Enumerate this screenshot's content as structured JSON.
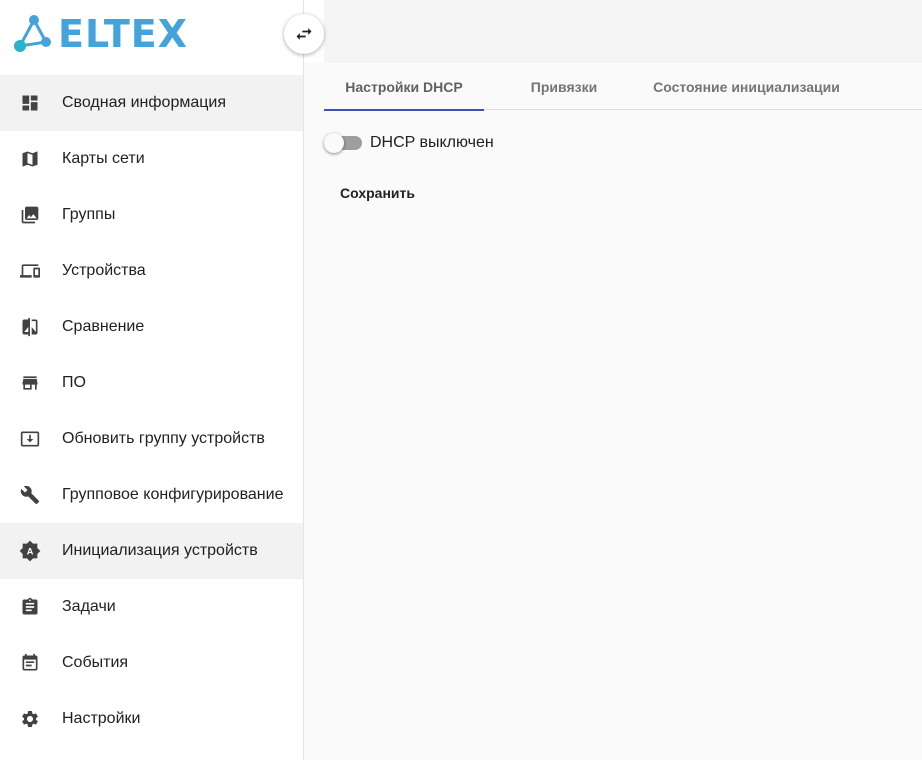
{
  "logo": {
    "text": "ELTEX",
    "mark_colors": [
      "#45a3dc",
      "#2bb1c9"
    ]
  },
  "toggle": {
    "icon": "swap-horiz-icon"
  },
  "sidebar": {
    "items": [
      {
        "label": "Сводная информация",
        "icon": "dashboard-icon",
        "active": true
      },
      {
        "label": "Карты сети",
        "icon": "map-icon",
        "active": false
      },
      {
        "label": "Группы",
        "icon": "photo-library-icon",
        "active": false
      },
      {
        "label": "Устройства",
        "icon": "devices-icon",
        "active": false
      },
      {
        "label": "Сравнение",
        "icon": "compare-icon",
        "active": false
      },
      {
        "label": "ПО",
        "icon": "store-icon",
        "active": false
      },
      {
        "label": "Обновить группу устройств",
        "icon": "system-update-icon",
        "active": false
      },
      {
        "label": "Групповое конфигурирование",
        "icon": "wrench-icon",
        "active": false
      },
      {
        "label": "Инициализация устройств",
        "icon": "brightness-auto-icon",
        "active": true
      },
      {
        "label": "Задачи",
        "icon": "assignment-icon",
        "active": false
      },
      {
        "label": "События",
        "icon": "event-note-icon",
        "active": false
      },
      {
        "label": "Настройки",
        "icon": "gear-icon",
        "active": false
      }
    ]
  },
  "tabs": [
    {
      "label": "Настройки DHCP",
      "active": true
    },
    {
      "label": "Привязки",
      "active": false
    },
    {
      "label": "Состояние инициализации",
      "active": false
    }
  ],
  "dhcp": {
    "label": "DHCP выключен",
    "enabled": false
  },
  "actions": {
    "save_label": "Сохранить"
  },
  "colors": {
    "accent": "#3f51b5",
    "logo": "#45a3dc",
    "active_bg": "#f2f2f2"
  }
}
